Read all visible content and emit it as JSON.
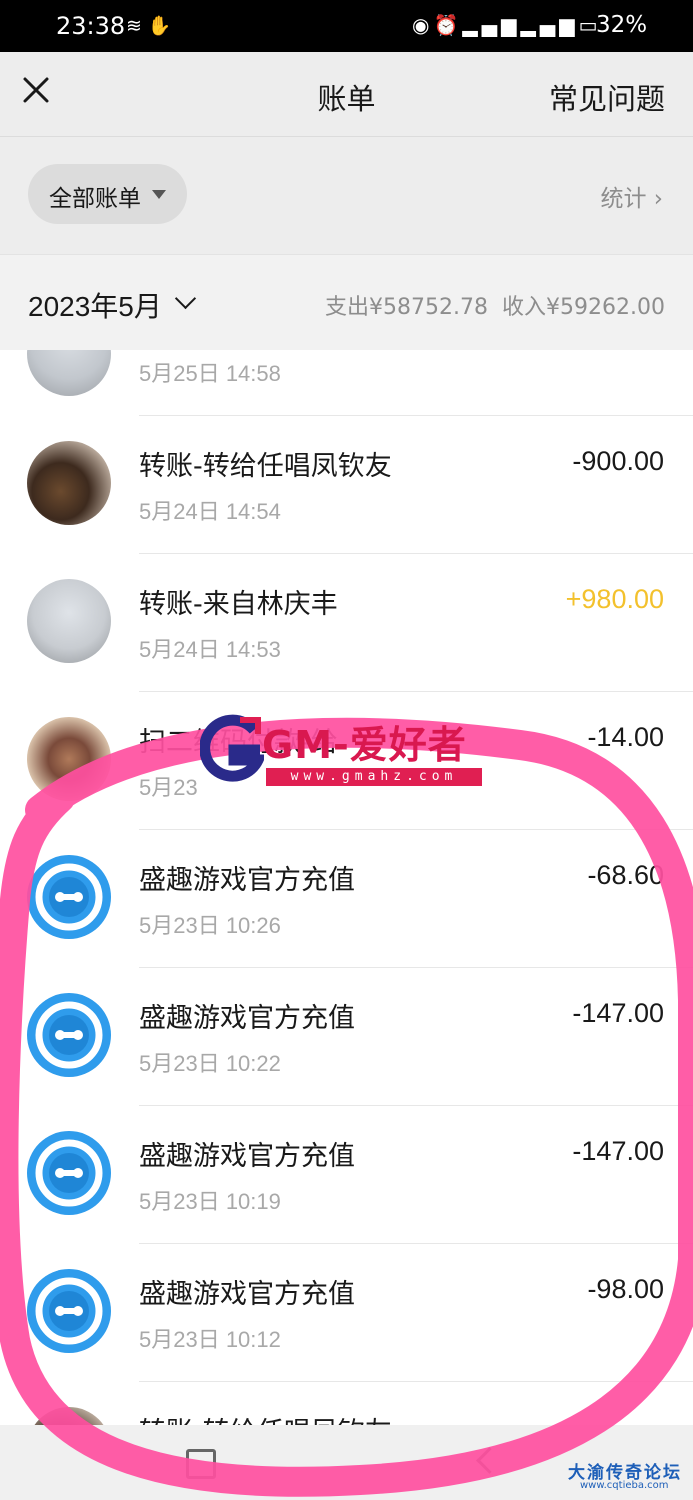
{
  "status_bar": {
    "time": "23:38",
    "battery": "32%",
    "icons": [
      "hotspot-icon",
      "hand-icon",
      "eye-icon",
      "alarm-icon",
      "signal-4g-icon",
      "signal-2g-icon",
      "battery-icon"
    ]
  },
  "header": {
    "title": "账单",
    "faq": "常见问题",
    "close_icon": "close-icon"
  },
  "filter": {
    "label": "全部账单",
    "stats": "统计 ›"
  },
  "month": {
    "label": "2023年5月",
    "expense": "支出¥58752.78",
    "income": "收入¥59262.00"
  },
  "transactions": [
    {
      "name": "",
      "date": "5月25日 14:58",
      "amount": "",
      "avatar": "photo"
    },
    {
      "name": "转账-转给任唱凤钦友",
      "date": "5月24日 14:54",
      "amount": "-900.00",
      "avatar": "photo"
    },
    {
      "name": "转账-来自林庆丰",
      "date": "5月24日 14:53",
      "amount": "+980.00",
      "avatar": "photo"
    },
    {
      "name": "扫二维码付款-给",
      "date": "5月23",
      "amount": "-14.00",
      "avatar": "photo"
    },
    {
      "name": "盛趣游戏官方充值",
      "date": "5月23日 10:26",
      "amount": "-68.60",
      "avatar": "game-logo"
    },
    {
      "name": "盛趣游戏官方充值",
      "date": "5月23日 10:22",
      "amount": "-147.00",
      "avatar": "game-logo"
    },
    {
      "name": "盛趣游戏官方充值",
      "date": "5月23日 10:19",
      "amount": "-147.00",
      "avatar": "game-logo"
    },
    {
      "name": "盛趣游戏官方充值",
      "date": "5月23日 10:12",
      "amount": "-98.00",
      "avatar": "game-logo"
    },
    {
      "name": "转账-转给任唱凤钦友",
      "date": "",
      "amount": "",
      "avatar": "photo"
    }
  ],
  "watermarks": {
    "gm_text": "GM-爱好者",
    "gm_url": "www.gmahz.com",
    "forum_title": "大渝传奇论坛",
    "forum_url": "www.cqtieba.com"
  },
  "colors": {
    "income": "#f3c12d",
    "highlight_circle": "#ff4fa0",
    "game_logo": "#2f9cec"
  }
}
